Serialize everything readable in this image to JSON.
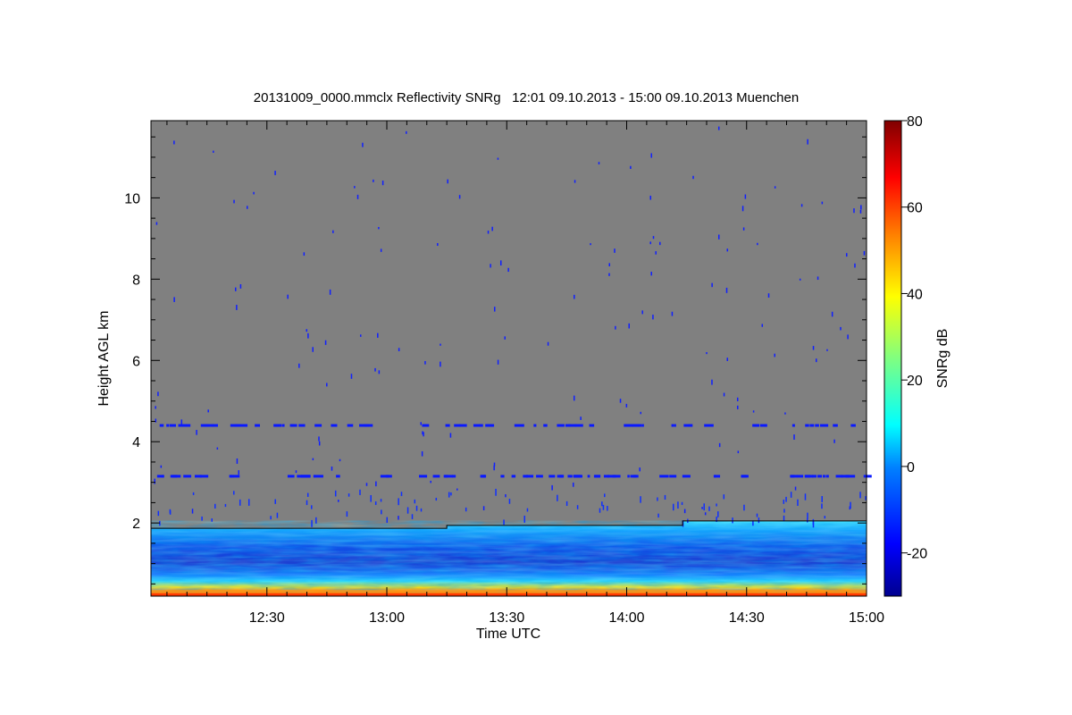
{
  "chart_data": {
    "type": "heatmap",
    "title": "20131009_0000.mmclx Reflectivity SNRg   12:01 09.10.2013 - 15:00 09.10.2013 Muenchen",
    "xlabel": "Time UTC",
    "ylabel": "Height AGL km",
    "x_range_minutes": [
      721,
      900
    ],
    "x_ticks": [
      {
        "minute": 750,
        "label": "12:30"
      },
      {
        "minute": 780,
        "label": "13:00"
      },
      {
        "minute": 810,
        "label": "13:30"
      },
      {
        "minute": 840,
        "label": "14:00"
      },
      {
        "minute": 870,
        "label": "14:30"
      },
      {
        "minute": 900,
        "label": "15:00"
      }
    ],
    "ylim": [
      0.2,
      11.9
    ],
    "y_ticks": [
      {
        "value": 2,
        "label": "2"
      },
      {
        "value": 4,
        "label": "4"
      },
      {
        "value": 6,
        "label": "6"
      },
      {
        "value": 8,
        "label": "8"
      },
      {
        "value": 10,
        "label": "10"
      }
    ],
    "colorbar": {
      "label": "SNRg dB",
      "range": [
        -30,
        80
      ],
      "ticks": [
        {
          "value": -20,
          "label": "-20"
        },
        {
          "value": 0,
          "label": "0"
        },
        {
          "value": 20,
          "label": "20"
        },
        {
          "value": 40,
          "label": "40"
        },
        {
          "value": 60,
          "label": "60"
        },
        {
          "value": 80,
          "label": "80"
        }
      ]
    },
    "background_color": "#808080",
    "colormap": [
      "#00008f",
      "#0000ff",
      "#0080ff",
      "#00ffff",
      "#80ff80",
      "#ffff00",
      "#ff8000",
      "#ff0000",
      "#800000"
    ],
    "layers": [
      {
        "name": "boundary layer top",
        "x": [
          721,
          795,
          795,
          854,
          854,
          900
        ],
        "height_km": [
          1.87,
          1.87,
          1.94,
          1.94,
          2.05,
          2.05
        ]
      },
      {
        "name": "surface strong echo",
        "height_km": [
          0.2,
          0.35
        ],
        "snr_db": 45
      }
    ],
    "clutter_lines_km": [
      4.4,
      3.15
    ]
  }
}
